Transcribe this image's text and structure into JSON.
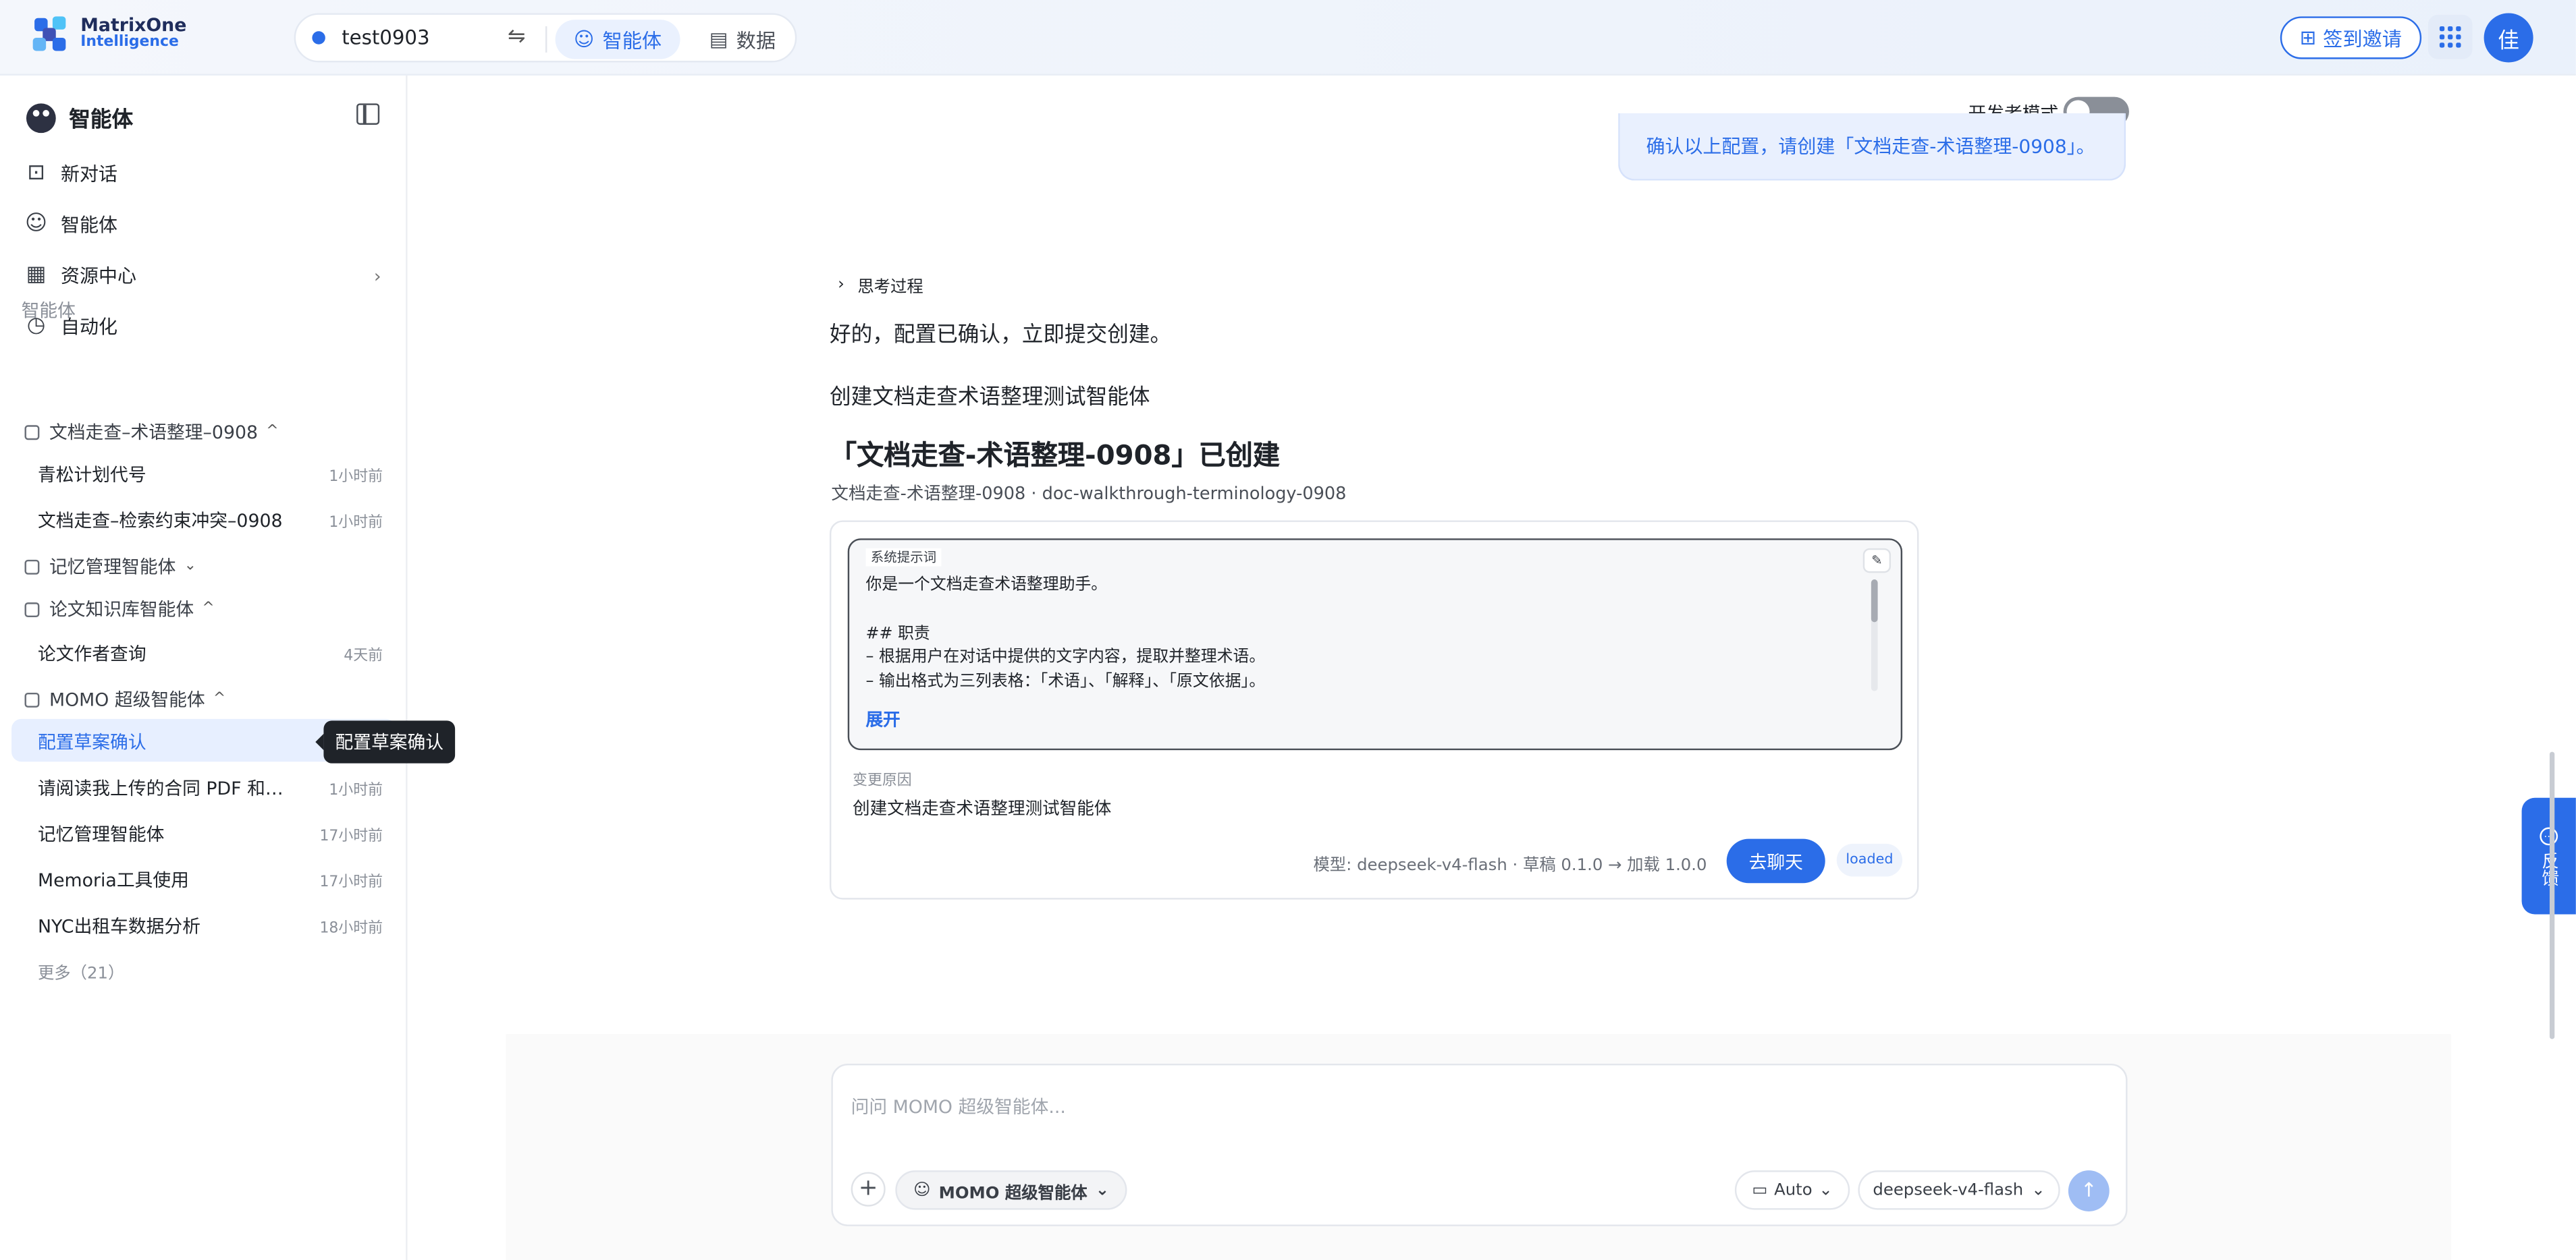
{
  "app": {
    "logo_line1": "MatrixOne",
    "logo_line2": "Intelligence",
    "workspace": "test0903",
    "tabs": [
      {
        "label": "智能体",
        "active": true
      },
      {
        "label": "数据",
        "active": false
      }
    ],
    "invite_label": "签到邀请",
    "avatar_text": "佳",
    "accent": "#2b6de8"
  },
  "sidebar": {
    "title": "智能体",
    "nav": [
      {
        "label": "新对话",
        "icon": "new-chat-icon"
      },
      {
        "label": "智能体",
        "icon": "agent-icon"
      },
      {
        "label": "资源中心",
        "icon": "grid-icon"
      },
      {
        "label": "自动化",
        "icon": "clock-icon"
      }
    ],
    "section_label": "智能体",
    "groups": [
      {
        "label": "文档走查–术语整理–0908",
        "expanded": true,
        "items": [
          {
            "title": "青松计划代号",
            "time": "1小时前"
          },
          {
            "title": "文档走查–检索约束冲突–0908",
            "time": "1小时前"
          }
        ]
      },
      {
        "label": "记忆管理智能体",
        "expanded": false,
        "items": []
      },
      {
        "label": "论文知识库智能体",
        "expanded": true,
        "items": [
          {
            "title": "论文作者查询",
            "time": "4天前"
          }
        ]
      },
      {
        "label": "MOMO 超级智能体",
        "expanded": true,
        "items": [
          {
            "title": "配置草案确认",
            "time": "",
            "active": true
          },
          {
            "title": "请阅读我上传的合同 PDF 和审查清单",
            "time": "1小时前"
          },
          {
            "title": "记忆管理智能体",
            "time": "17小时前"
          },
          {
            "title": "Memoria工具使用",
            "time": "17小时前"
          },
          {
            "title": "NYC出租车数据分析",
            "time": "18小时前"
          }
        ]
      }
    ],
    "more_label": "更多（21）",
    "tooltip": "配置草案确认"
  },
  "main": {
    "dev_mode_label": "开发者模式",
    "dev_mode_on": false,
    "user_message": "确认以上配置，请创建「文档走查-术语整理-0908」。",
    "think_label": "思考过程",
    "reply_1": "好的，配置已确认，立即提交创建。",
    "reply_2": "创建文档走查术语整理测试智能体",
    "created_title": "「文档走查-术语整理-0908」已创建",
    "created_sub": "文档走查-术语整理-0908 · doc-walkthrough-terminology-0908",
    "card": {
      "prompt_label": "系统提示词",
      "prompt_text": "你是一个文档走查术语整理助手。\n\n## 职责\n– 根据用户在对话中提供的文字内容，提取并整理术语。\n– 输出格式为三列表格：「术语」、「解释」、「原文依据」。",
      "expand_label": "展开",
      "change_label": "变更原因",
      "change_value": "创建文档走查术语整理测试智能体",
      "meta": "模型: deepseek-v4-flash · 草稿 0.1.0 → 加载 1.0.0",
      "chat_button": "去聊天",
      "status_badge": "loaded"
    }
  },
  "composer": {
    "placeholder": "问问 MOMO 超级智能体...",
    "agent_chip": "MOMO 超级智能体",
    "auto_label": "Auto",
    "model_label": "deepseek-v4-flash"
  },
  "feedback_label": "反馈"
}
